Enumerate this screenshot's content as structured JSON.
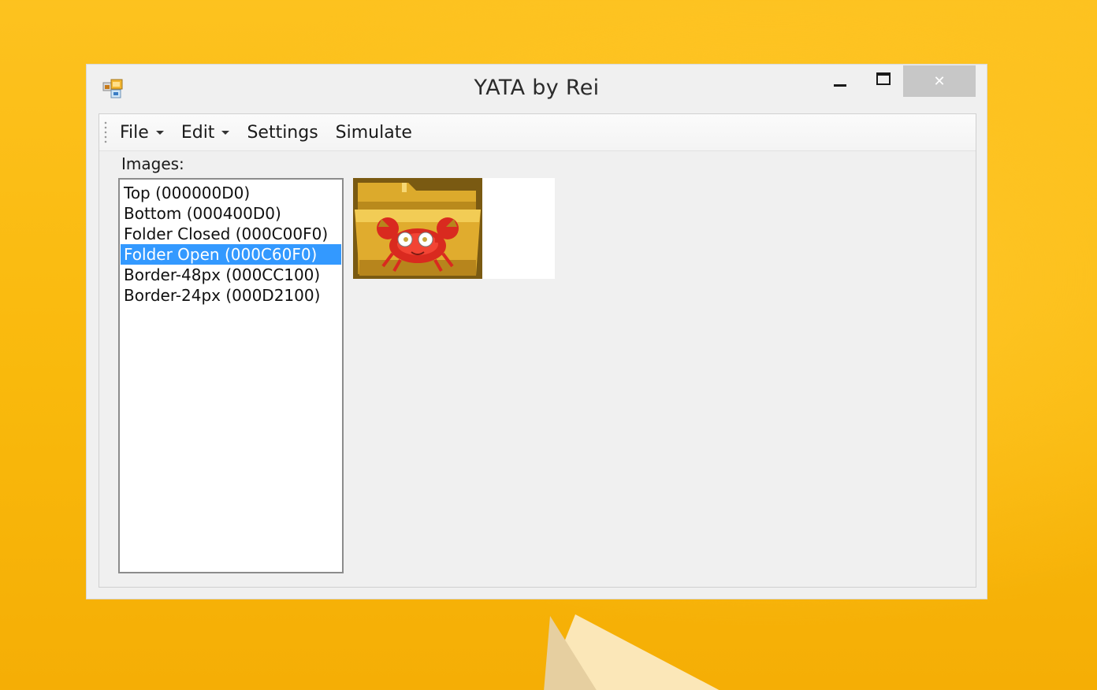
{
  "window": {
    "title": "YATA by Rei",
    "close_symbol": "✕"
  },
  "menu": {
    "items": [
      {
        "label": "File",
        "has_dropdown": true
      },
      {
        "label": "Edit",
        "has_dropdown": true
      },
      {
        "label": "Settings",
        "has_dropdown": false
      },
      {
        "label": "Simulate",
        "has_dropdown": false
      }
    ]
  },
  "images": {
    "label": "Images:",
    "items": [
      {
        "label": "Top (000000D0)",
        "selected": false
      },
      {
        "label": "Bottom (000400D0)",
        "selected": false
      },
      {
        "label": "Folder Closed (000C00F0)",
        "selected": false
      },
      {
        "label": "Folder Open (000C60F0)",
        "selected": true
      },
      {
        "label": "Border-48px (000CC100)",
        "selected": false
      },
      {
        "label": "Border-24px (000D2100)",
        "selected": false
      }
    ]
  },
  "preview": {
    "icon": "crab-folder-icon"
  },
  "colors": {
    "selection": "#3399ff",
    "background": "#f0f0f0",
    "desktop": "#fbbf14"
  }
}
